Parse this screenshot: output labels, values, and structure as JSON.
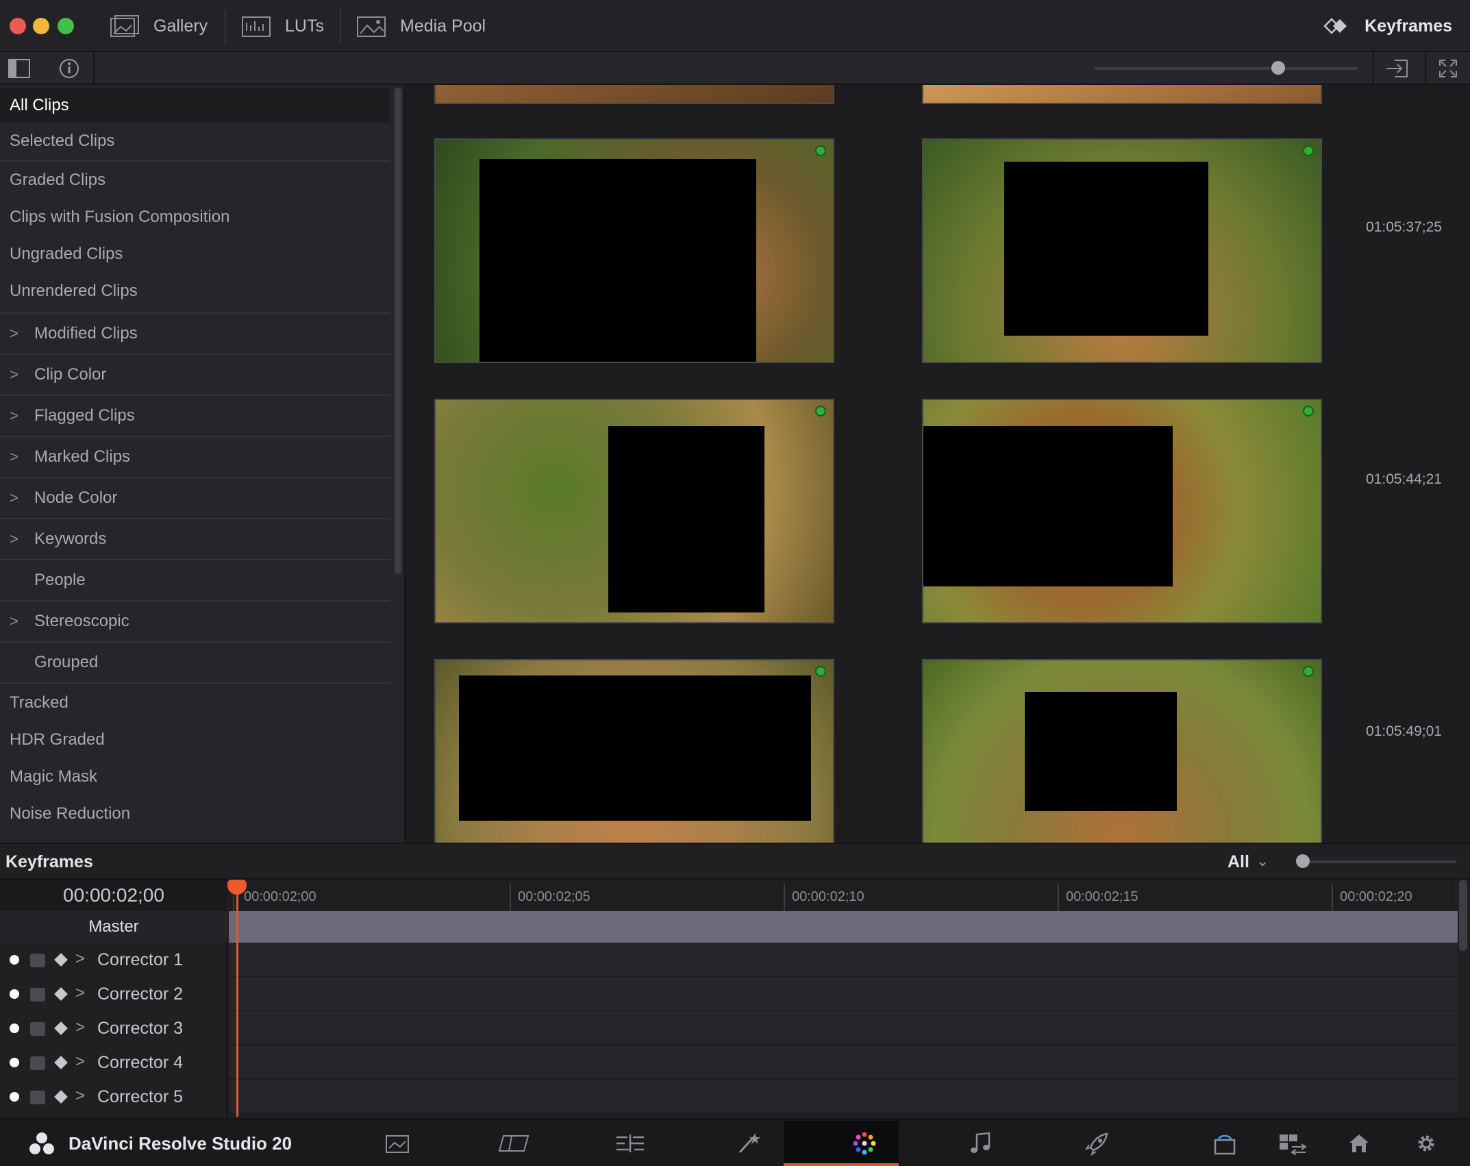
{
  "titlebar": {
    "tabs": [
      {
        "label": "Gallery",
        "icon": "gallery-icon"
      },
      {
        "label": "LUTs",
        "icon": "luts-icon"
      },
      {
        "label": "Media Pool",
        "icon": "media-pool-icon"
      }
    ],
    "right_panel_label": "Keyframes"
  },
  "sidebar": {
    "items": [
      {
        "label": "All Clips",
        "selected": true
      },
      {
        "label": "Selected Clips"
      },
      {
        "label": "Graded Clips"
      },
      {
        "label": "Clips with Fusion Composition"
      },
      {
        "label": "Ungraded Clips"
      },
      {
        "label": "Unrendered Clips"
      },
      {
        "label": "Modified Clips",
        "expandable": true
      },
      {
        "label": "Clip Color",
        "expandable": true
      },
      {
        "label": "Flagged Clips",
        "expandable": true
      },
      {
        "label": "Marked Clips",
        "expandable": true
      },
      {
        "label": "Node Color",
        "expandable": true
      },
      {
        "label": "Keywords",
        "expandable": true
      },
      {
        "label": "People"
      },
      {
        "label": "Stereoscopic",
        "expandable": true
      },
      {
        "label": "Grouped"
      },
      {
        "label": "Tracked"
      },
      {
        "label": "HDR Graded"
      },
      {
        "label": "Magic Mask"
      },
      {
        "label": "Noise Reduction"
      }
    ]
  },
  "gallery": {
    "row_timecodes": [
      "01:05:37;25",
      "01:05:44;21",
      "01:05:49;01"
    ]
  },
  "keyframes": {
    "title": "Keyframes",
    "filter_value": "All",
    "current_time": "00:00:02;00",
    "master_label": "Master",
    "ruler_labels": [
      "00:00:02;00",
      "00:00:02;05",
      "00:00:02;10",
      "00:00:02;15",
      "00:00:02;20"
    ],
    "correctors": [
      "Corrector 1",
      "Corrector 2",
      "Corrector 3",
      "Corrector 4",
      "Corrector 5"
    ]
  },
  "bottombar": {
    "brand": "DaVinci Resolve Studio 20",
    "pages": [
      "media-page-icon",
      "cut-page-icon",
      "edit-page-icon",
      "fusion-page-icon",
      "color-page-icon",
      "fairlight-page-icon",
      "deliver-page-icon"
    ],
    "active_page": "color-page-icon"
  },
  "colors": {
    "accent_orange": "#e9562c",
    "flag_green": "#2fae3a",
    "traffic_red": "#ee5a52",
    "traffic_yellow": "#f1b837",
    "traffic_green": "#3fc04a"
  }
}
